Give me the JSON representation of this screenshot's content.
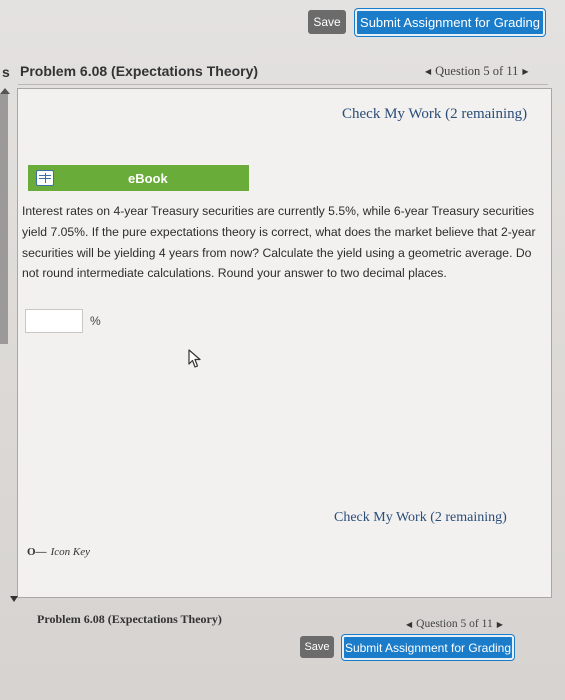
{
  "toolbar": {
    "save_label": "Save",
    "submit_label": "Submit Assignment for Grading"
  },
  "header": {
    "left_fragment": "s",
    "problem_title": "Problem 6.08 (Expectations Theory)",
    "question_nav": "Question 5 of 11"
  },
  "card": {
    "check_my_work_top": "Check My Work (2 remaining)",
    "check_my_work_bottom": "Check My Work (2 remaining)",
    "ebook_label": "eBook",
    "question_text": "Interest rates on 4-year Treasury securities are currently 5.5%, while 6-year Treasury securities yield 7.05%. If the pure expectations theory is correct, what does the market believe that 2-year securities will be yielding 4 years from now? Calculate the yield using a geometric average. Do not round intermediate calculations. Round your answer to two decimal places.",
    "answer_value": "",
    "answer_unit": "%",
    "icon_key_label": "Icon Key",
    "icon_key_symbol": "O—"
  },
  "footer": {
    "problem_title": "Problem 6.08 (Expectations Theory)",
    "question_nav": "Question 5 of 11",
    "save_label": "Save",
    "submit_label": "Submit Assignment for Grading"
  },
  "colors": {
    "accent_blue": "#1b7cc9",
    "ebook_green": "#6aac3a",
    "link_blue": "#2a4d7a"
  }
}
